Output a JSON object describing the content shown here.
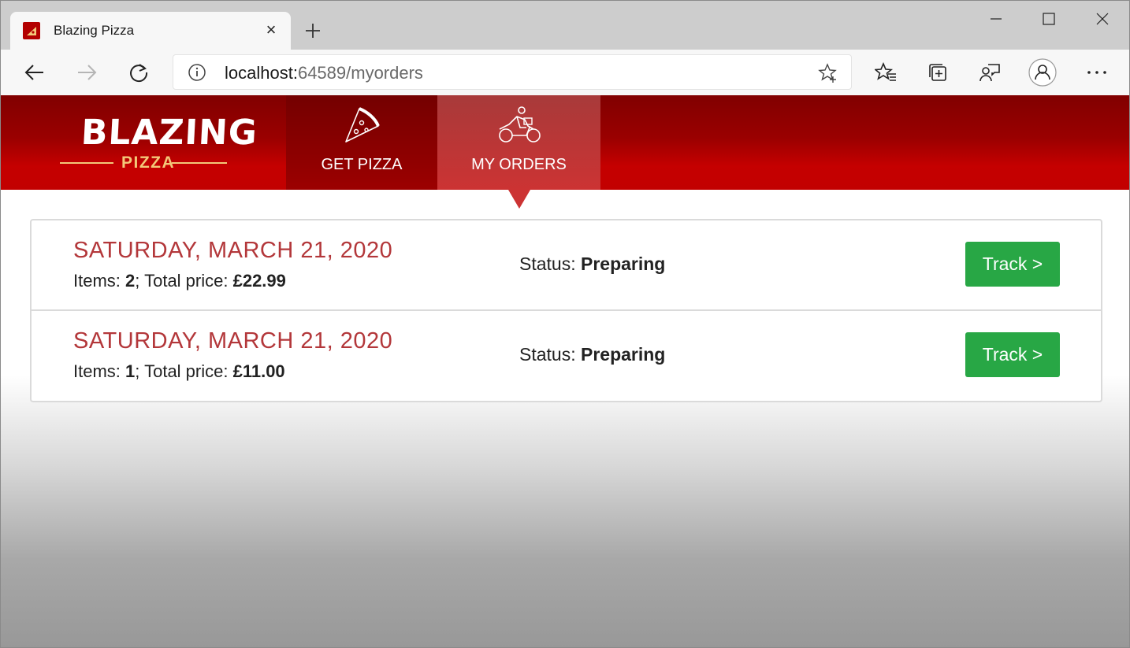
{
  "browser": {
    "tab_title": "Blazing Pizza",
    "tab_close": "×",
    "address_host": "localhost:",
    "address_rest": "64589/myorders"
  },
  "header": {
    "logo_main": "BLAZING",
    "logo_sub": "PIZZA",
    "nav": [
      {
        "label": "GET PIZZA",
        "icon": "pizza-slice-icon"
      },
      {
        "label": "MY ORDERS",
        "icon": "motorbike-icon",
        "active": true
      }
    ]
  },
  "orders": [
    {
      "date": "SATURDAY, MARCH 21, 2020",
      "items_label": "Items: ",
      "items": "2",
      "price_label": "; Total price: ",
      "price": "£22.99",
      "status_label": "Status: ",
      "status": "Preparing",
      "button": "Track >"
    },
    {
      "date": "SATURDAY, MARCH 21, 2020",
      "items_label": "Items: ",
      "items": "1",
      "price_label": "; Total price: ",
      "price": "£11.00",
      "status_label": "Status: ",
      "status": "Preparing",
      "button": "Track >"
    }
  ],
  "colors": {
    "brand_red": "#c50000",
    "date_red": "#b3373a",
    "track_green": "#28a745",
    "logo_gold": "#f3c879"
  }
}
